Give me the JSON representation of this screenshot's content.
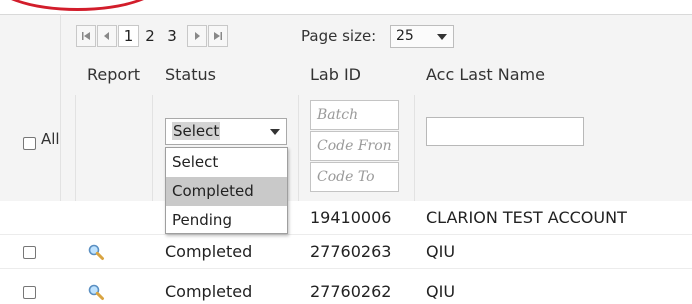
{
  "pager": {
    "pages": [
      "1",
      "2",
      "3"
    ],
    "current_page": "1",
    "page_size_label": "Page size:",
    "page_size_value": "25"
  },
  "columns": {
    "report": "Report",
    "status": "Status",
    "lab_id": "Lab ID",
    "acc_last_name": "Acc Last Name"
  },
  "filters": {
    "all_label": "All",
    "status_selected": "Select",
    "batch_placeholder": "Batch",
    "code_from_placeholder": "Code Fron",
    "code_to_placeholder": "Code To",
    "name_value": ""
  },
  "status_dropdown": {
    "options": [
      "Select",
      "Completed",
      "Pending"
    ],
    "highlighted": "Completed"
  },
  "rows": [
    {
      "status": "",
      "lab_id": "19410006",
      "acc_last_name": "CLARION TEST ACCOUNT"
    },
    {
      "status": "Completed",
      "lab_id": "27760263",
      "acc_last_name": "QIU"
    },
    {
      "status": "Completed",
      "lab_id": "27760262",
      "acc_last_name": "QIU"
    }
  ],
  "colors": {
    "annotation": "#d21d2b",
    "header_bg": "#f4f4f4",
    "dropdown_highlight": "#c9c9c9"
  },
  "icons": [
    "first-page-icon",
    "prev-page-icon",
    "next-page-icon",
    "last-page-icon",
    "magnifier-icon",
    "chevron-down-icon"
  ]
}
